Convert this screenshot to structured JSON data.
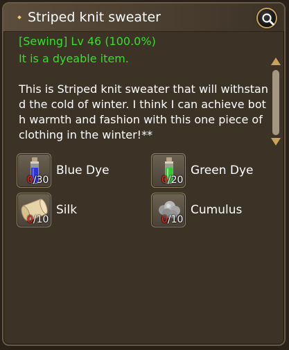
{
  "tooltip": {
    "title": "Striped knit sweater",
    "skill_line": "[Sewing] Lv 46 (100.0%)",
    "dye_line": "It is a dyeable item.",
    "description": "This is Striped knit sweater that will withstand the cold of winter. I think I can achieve both warmth and fashion with this one piece of clothing in the winter!**",
    "materials": [
      {
        "name": "Blue Dye",
        "have": "0",
        "need": "/30",
        "icon": "blue-dye-bottle-icon"
      },
      {
        "name": "Green Dye",
        "have": "0",
        "need": "/20",
        "icon": "green-dye-bottle-icon"
      },
      {
        "name": "Silk",
        "have": "0",
        "need": "/10",
        "icon": "silk-scroll-icon"
      },
      {
        "name": "Cumulus",
        "have": "0",
        "need": "/10",
        "icon": "cumulus-cloud-icon"
      }
    ]
  },
  "colors": {
    "accent_green": "#33e02b",
    "missing_red": "#ff2020",
    "gold_trim": "#c9a35a"
  }
}
